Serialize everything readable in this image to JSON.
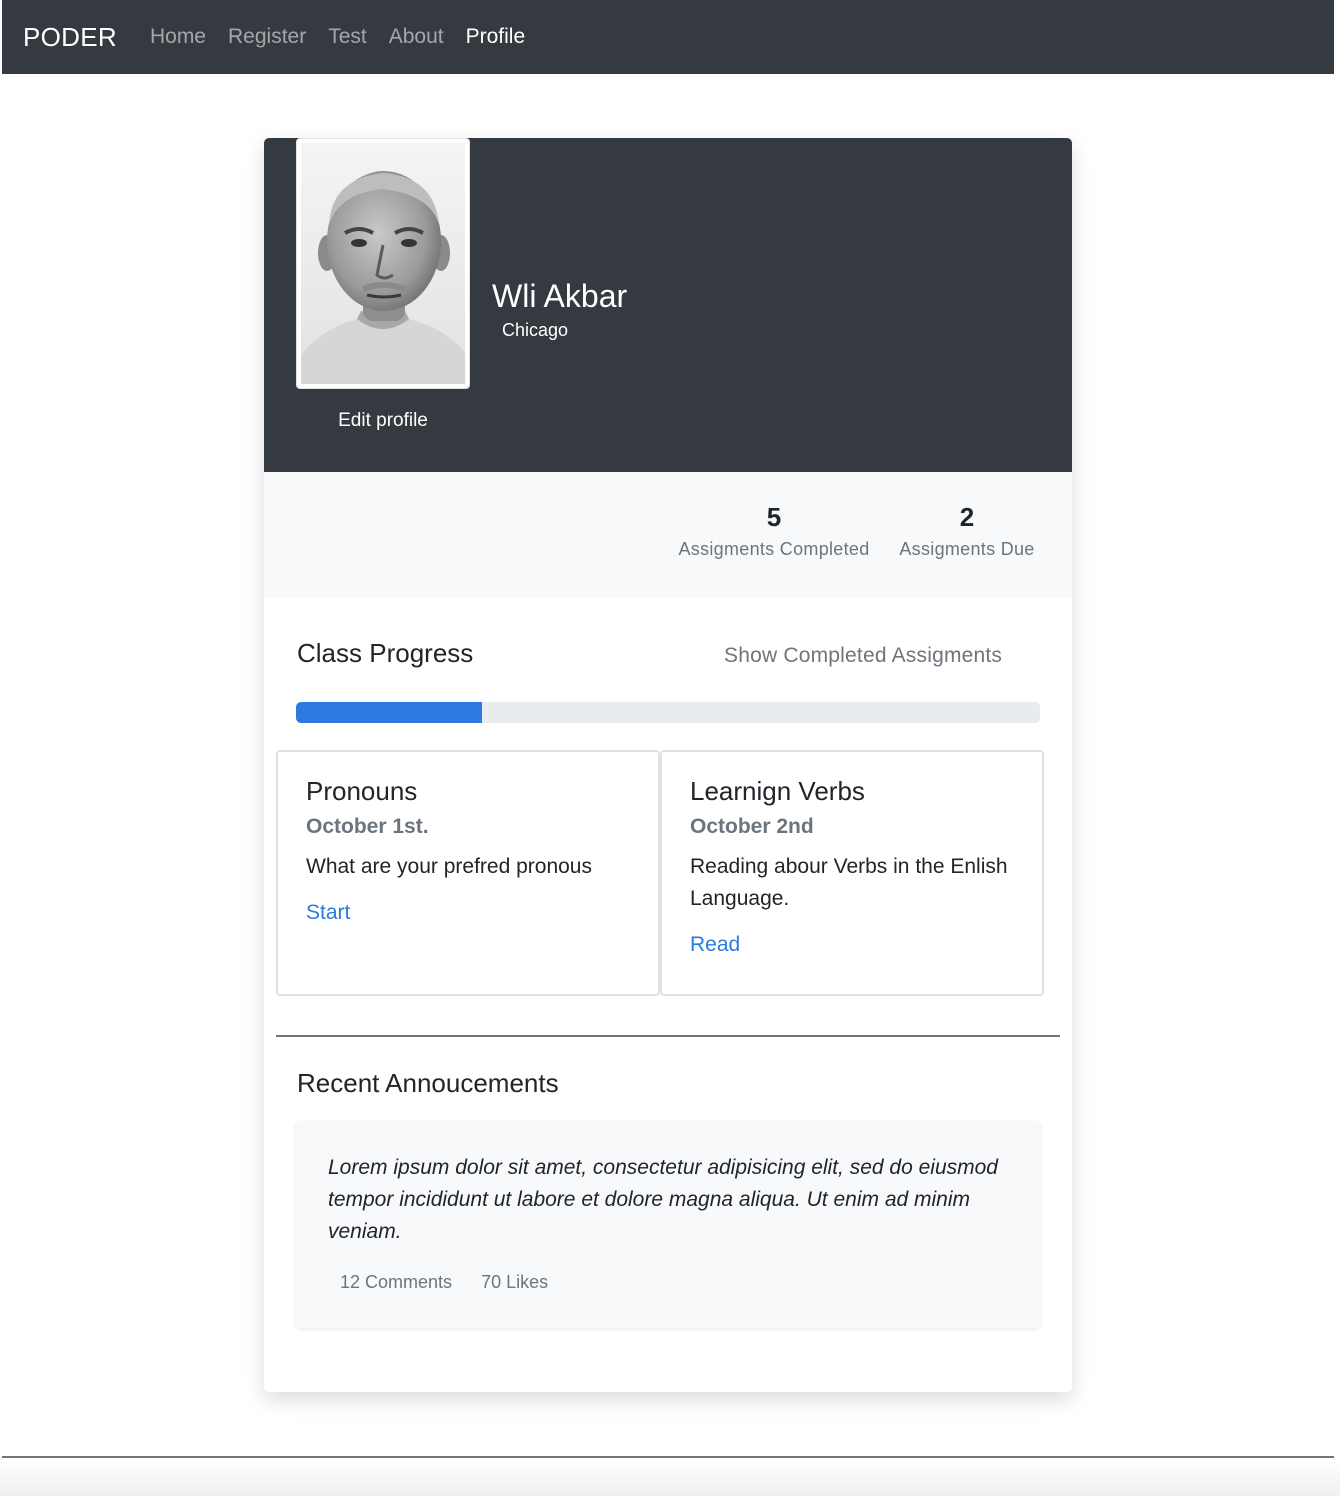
{
  "navbar": {
    "brand": "PODER",
    "links": [
      {
        "label": "Home",
        "active": false
      },
      {
        "label": "Register",
        "active": false
      },
      {
        "label": "Test",
        "active": false
      },
      {
        "label": "About",
        "active": false
      },
      {
        "label": "Profile",
        "active": true
      }
    ]
  },
  "profile": {
    "name": "Wli Akbar",
    "city": "Chicago",
    "edit_label": "Edit profile",
    "avatar_icon": "person-photo"
  },
  "stats": {
    "completed": {
      "value": "5",
      "label": "Assigments Completed"
    },
    "due": {
      "value": "2",
      "label": "Assigments Due"
    }
  },
  "progress": {
    "title": "Class Progress",
    "toggle_label": "Show Completed Assigments",
    "value_percent": 25,
    "fill_color": "#2a7ae2"
  },
  "assignments": [
    {
      "title": "Pronouns",
      "date": "October 1st.",
      "description": "What are your prefred pronous",
      "action": "Start"
    },
    {
      "title": "Learnign Verbs",
      "date": "October 2nd",
      "description": "Reading abour Verbs in the Enlish Language.",
      "action": "Read"
    }
  ],
  "announcements": {
    "title": "Recent Annoucements",
    "items": [
      {
        "text": "Lorem ipsum dolor sit amet, consectetur adipisicing elit, sed do eiusmod tempor incididunt ut labore et dolore magna aliqua. Ut enim ad minim veniam.",
        "comments": "12 Comments",
        "likes": "70 Likes"
      }
    ]
  },
  "colors": {
    "navbar_bg": "#343a40",
    "accent": "#2a7ae2",
    "muted": "#6c757d"
  }
}
